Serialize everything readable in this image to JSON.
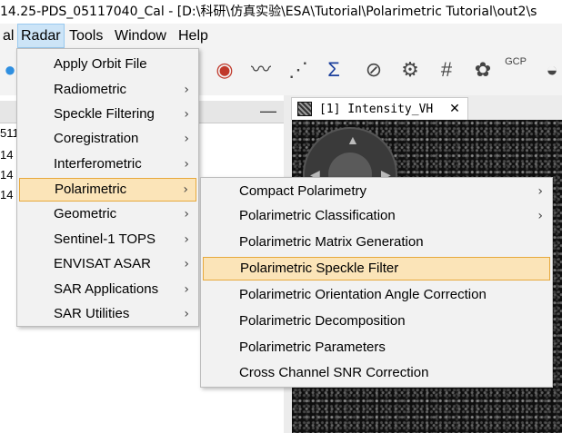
{
  "window": {
    "title": "14.25-PDS_05117040_Cal - [D:\\科研\\仿真实验\\ESA\\Tutorial\\Polarimetric Tutorial\\out2\\s"
  },
  "menubar": {
    "items": [
      "al",
      "Radar",
      "Tools",
      "Window",
      "Help"
    ]
  },
  "toolbar": {
    "icons": [
      "orbit-icon",
      "radiometric-icon",
      "spectrum-icon",
      "line-plot-icon",
      "scatter-plot-icon",
      "sigma-icon",
      "eye-tool-icon",
      "tool-icon",
      "grid-icon",
      "gcp-icon",
      "gcp-text-icon",
      "dome-icon"
    ],
    "sigma_glyph": "Σ",
    "gcp_label": "GCP"
  },
  "left_panel": {
    "minimize_glyph": "—",
    "tree_stubs": [
      "511",
      "14",
      "14",
      "14"
    ]
  },
  "document": {
    "tab_label": "[1] Intensity_VH",
    "close_glyph": "✕"
  },
  "radar_menu": {
    "items": [
      {
        "label": "Apply Orbit File",
        "submenu": false
      },
      {
        "label": "Radiometric",
        "submenu": true
      },
      {
        "label": "Speckle Filtering",
        "submenu": true
      },
      {
        "label": "Coregistration",
        "submenu": true
      },
      {
        "label": "Interferometric",
        "submenu": true
      },
      {
        "label": "Polarimetric",
        "submenu": true,
        "highlighted": true
      },
      {
        "label": "Geometric",
        "submenu": true
      },
      {
        "label": "Sentinel-1 TOPS",
        "submenu": true
      },
      {
        "label": "ENVISAT ASAR",
        "submenu": true
      },
      {
        "label": "SAR Applications",
        "submenu": true
      },
      {
        "label": "SAR Utilities",
        "submenu": true
      }
    ],
    "arrow_glyph": "›"
  },
  "polarimetric_menu": {
    "items": [
      {
        "label": "Compact Polarimetry",
        "submenu": true
      },
      {
        "label": "Polarimetric Classification",
        "submenu": true
      },
      {
        "label": "Polarimetric Matrix Generation",
        "submenu": false
      },
      {
        "label": "Polarimetric Speckle Filter",
        "submenu": false,
        "highlighted": true
      },
      {
        "label": "Polarimetric Orientation Angle Correction",
        "submenu": false
      },
      {
        "label": "Polarimetric Decomposition",
        "submenu": false
      },
      {
        "label": "Polarimetric Parameters",
        "submenu": false
      },
      {
        "label": "Cross Channel SNR Correction",
        "submenu": false
      }
    ]
  },
  "colors": {
    "menu_highlight_bg": "#fbe4b8",
    "menu_highlight_border": "#e7a93c",
    "menubar_active_bg": "#cce4f7"
  }
}
